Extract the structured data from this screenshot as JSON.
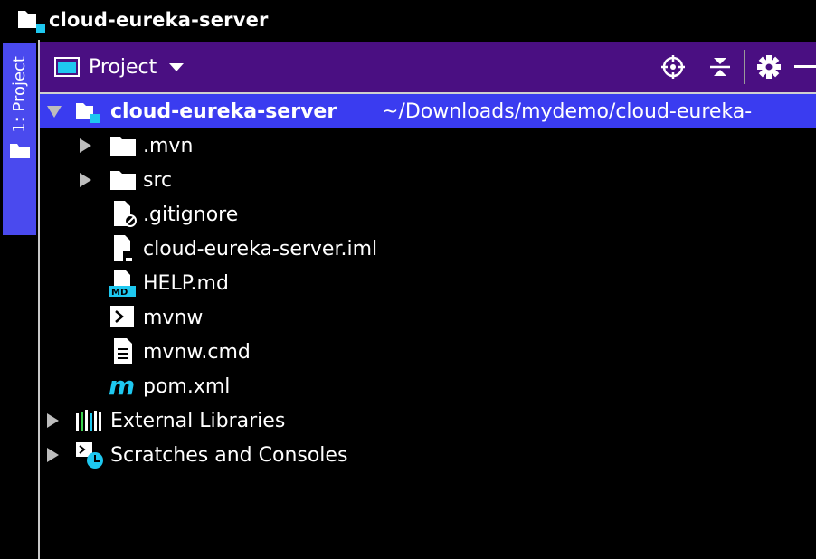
{
  "window": {
    "title": "cloud-eureka-server"
  },
  "sidebar": {
    "tab_label": "1: Project"
  },
  "panel": {
    "title": "Project",
    "actions": [
      "locate-icon",
      "collapse-all-icon",
      "gear-icon",
      "minimize-icon"
    ]
  },
  "tree": {
    "root": {
      "name": "cloud-eureka-server",
      "path": "~/Downloads/mydemo/cloud-eureka-"
    },
    "items": [
      {
        "label": ".mvn",
        "type": "folder",
        "expandable": true
      },
      {
        "label": "src",
        "type": "folder",
        "expandable": true
      },
      {
        "label": ".gitignore",
        "type": "ignored-file",
        "expandable": false
      },
      {
        "label": "cloud-eureka-server.iml",
        "type": "iml-file",
        "expandable": false
      },
      {
        "label": "HELP.md",
        "type": "markdown-file",
        "expandable": false
      },
      {
        "label": "mvnw",
        "type": "shell-file",
        "expandable": false
      },
      {
        "label": "mvnw.cmd",
        "type": "text-file",
        "expandable": false
      },
      {
        "label": "pom.xml",
        "type": "maven-file",
        "expandable": false
      }
    ],
    "external_libraries": "External Libraries",
    "scratches": "Scratches and Consoles"
  },
  "colors": {
    "selection": "#3a3cf0",
    "panel_header": "#4a0f82",
    "accent_cyan": "#1ec8f0",
    "sidebar_tab": "#4a4aee"
  }
}
